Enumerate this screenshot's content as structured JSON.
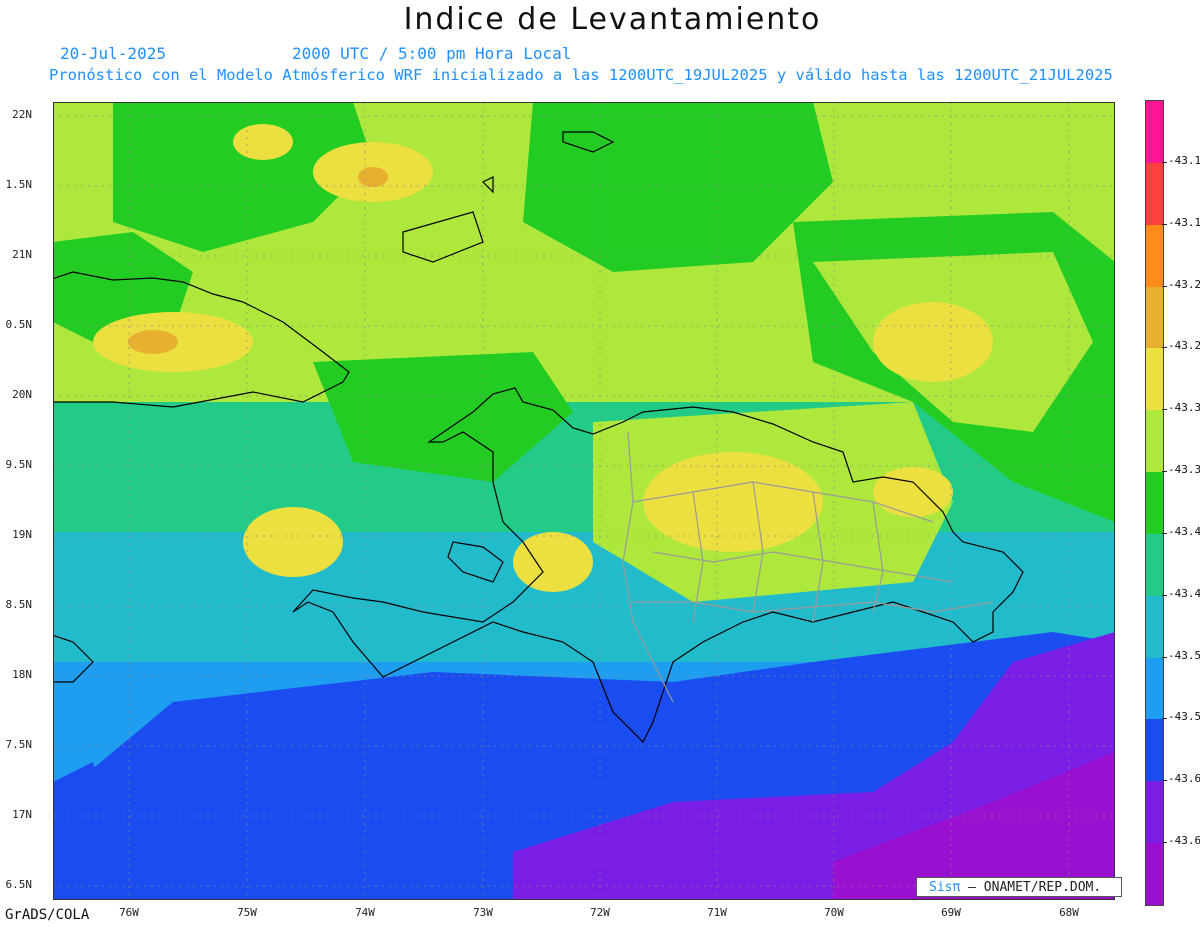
{
  "title": "Indice de Levantamiento",
  "header": {
    "date": "20-Jul-2025",
    "time": "2000 UTC / 5:00 pm Hora Local",
    "description": "Pronóstico con el Modelo Atmósferico WRF inicializado a las 1200UTC_19JUL2025 y válido hasta las  1200UTC_21JUL2025"
  },
  "lat_labels": [
    "22N",
    "1.5N",
    "21N",
    "0.5N",
    "20N",
    "9.5N",
    "19N",
    "8.5N",
    "18N",
    "7.5N",
    "17N",
    "6.5N"
  ],
  "lon_labels": [
    "76W",
    "75W",
    "74W",
    "73W",
    "72W",
    "71W",
    "70W",
    "69W",
    "68W"
  ],
  "colorbar": {
    "colors": [
      "#ff1493",
      "#ff4040",
      "#ff8c1a",
      "#e8b030",
      "#ebe040",
      "#aee83c",
      "#22cc22",
      "#22cc88",
      "#22bbcc",
      "#1e9ef0",
      "#1a4cf0",
      "#7a1ee6",
      "#9a10d0"
    ],
    "labels": [
      "-43.1",
      "-43.1",
      "-43.2",
      "-43.2",
      "-43.3",
      "-43.3",
      "-43.4",
      "-43.4",
      "-43.5",
      "-43.5",
      "-43.6",
      "-43.6"
    ]
  },
  "footer": {
    "credit": "GrADS/COLA",
    "brand_name": "Sisπ",
    "brand_org": "– ONAMET/REP.DOM."
  }
}
